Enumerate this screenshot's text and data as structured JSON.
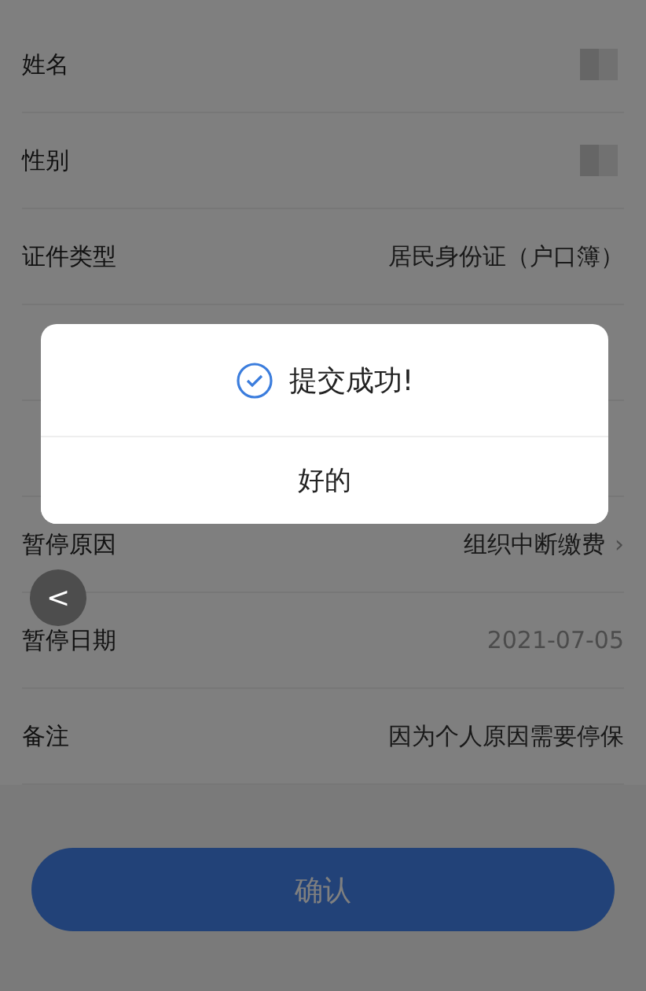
{
  "rows": [
    {
      "kind": "redacted",
      "label": "姓名"
    },
    {
      "kind": "redacted",
      "label": "性别"
    },
    {
      "kind": "text",
      "label": "证件类型",
      "value": "居民身份证（户口簿）"
    },
    {
      "kind": "covered"
    },
    {
      "kind": "covered"
    },
    {
      "kind": "select",
      "label": "暂停原因",
      "value": "组织中断缴费",
      "chevron": "›"
    },
    {
      "kind": "date",
      "label": "暂停日期",
      "value": "2021-07-05"
    },
    {
      "kind": "text",
      "label": "备注",
      "value": "因为个人原因需要停保"
    }
  ],
  "submit_button": "确认",
  "back_button": "<",
  "dialog": {
    "message": "提交成功!",
    "button": "好的"
  }
}
